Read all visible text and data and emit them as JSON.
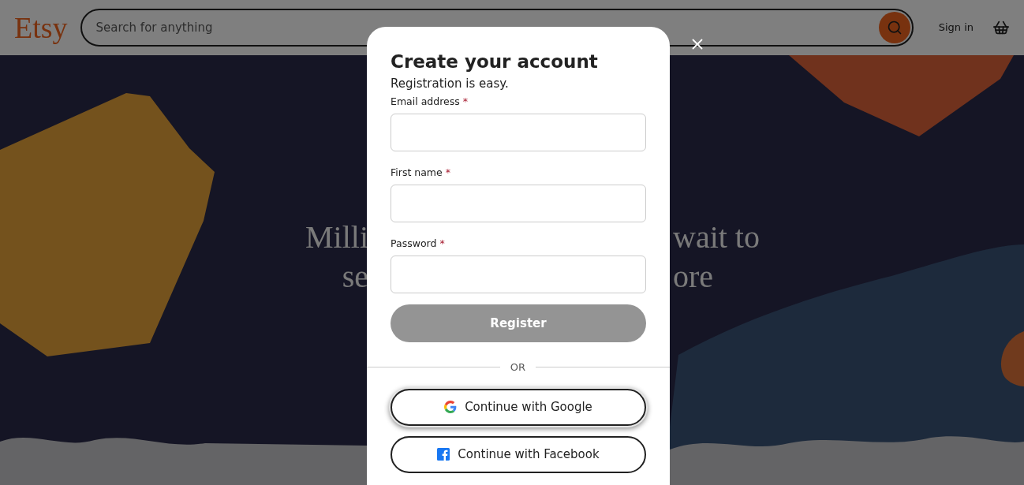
{
  "header": {
    "logo": "Etsy",
    "search": {
      "placeholder": "Search for anything"
    },
    "sign_in": "Sign in"
  },
  "hero": {
    "lines": [
      {
        "left": "Milli",
        "right": "wait to"
      },
      {
        "left": "se",
        "right": "ore"
      }
    ]
  },
  "modal": {
    "title": "Create your account",
    "subtitle": "Registration is easy.",
    "fields": [
      {
        "label": "Email address",
        "required_mark": "*"
      },
      {
        "label": "First name",
        "required_mark": "*"
      },
      {
        "label": "Password",
        "required_mark": "*"
      }
    ],
    "register": {
      "label": "Register",
      "disabled": true
    },
    "divider": "OR",
    "social": [
      {
        "kind": "google",
        "label": "Continue with Google",
        "focused": true
      },
      {
        "kind": "facebook",
        "label": "Continue with Facebook",
        "focused": false
      }
    ]
  }
}
